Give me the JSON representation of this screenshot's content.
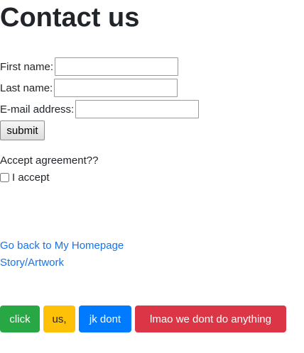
{
  "page": {
    "title": "Contact us"
  },
  "form": {
    "first_name_label": "First name:",
    "first_name_value": "",
    "last_name_label": "Last name:",
    "last_name_value": "",
    "email_label": "E-mail address:",
    "email_value": "",
    "submit_label": "submit"
  },
  "agreement": {
    "prompt": "Accept agreement??",
    "checkbox_label": "I accept",
    "checked": false
  },
  "links": {
    "homepage": "Go back to My Homepage",
    "story": "Story/Artwork"
  },
  "buttons": {
    "click": "click",
    "us": "us,",
    "jk_dont": "jk dont",
    "lmao": "lmao we dont do anything"
  },
  "colors": {
    "success": "#28a745",
    "warning": "#ffc107",
    "primary": "#007bff",
    "danger": "#dc3545",
    "link": "#1a73e8"
  }
}
